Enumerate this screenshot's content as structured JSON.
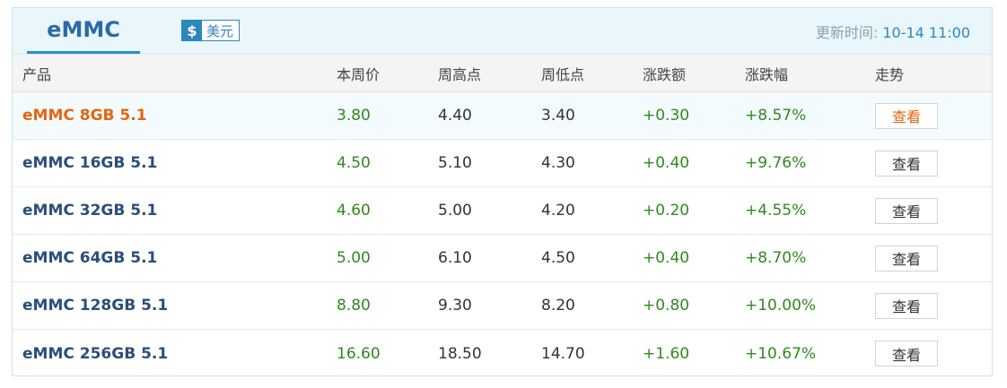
{
  "tab": {
    "label": "eMMC"
  },
  "currency": {
    "symbol": "$",
    "label": "美元"
  },
  "updated": {
    "label": "更新时间: ",
    "value": "10-14 11:00"
  },
  "columns": [
    "产品",
    "本周价",
    "周高点",
    "周低点",
    "涨跌额",
    "涨跌幅",
    "走势"
  ],
  "rows": [
    {
      "name": "eMMC 8GB 5.1",
      "price": "3.80",
      "high": "4.40",
      "low": "3.40",
      "change": "+0.30",
      "pct": "+8.57%",
      "action": "查看"
    },
    {
      "name": "eMMC 16GB 5.1",
      "price": "4.50",
      "high": "5.10",
      "low": "4.30",
      "change": "+0.40",
      "pct": "+9.76%",
      "action": "查看"
    },
    {
      "name": "eMMC 32GB 5.1",
      "price": "4.60",
      "high": "5.00",
      "low": "4.20",
      "change": "+0.20",
      "pct": "+4.55%",
      "action": "查看"
    },
    {
      "name": "eMMC 64GB 5.1",
      "price": "5.00",
      "high": "6.10",
      "low": "4.50",
      "change": "+0.40",
      "pct": "+8.70%",
      "action": "查看"
    },
    {
      "name": "eMMC 128GB 5.1",
      "price": "8.80",
      "high": "9.30",
      "low": "8.20",
      "change": "+0.80",
      "pct": "+10.00%",
      "action": "查看"
    },
    {
      "name": "eMMC 256GB 5.1",
      "price": "16.60",
      "high": "18.50",
      "low": "14.70",
      "change": "+1.60",
      "pct": "+10.67%",
      "action": "查看"
    }
  ],
  "colors": {
    "accent": "#2f86bd",
    "highlight": "#e4660e",
    "up": "#2e8a1c",
    "product": "#2a4e7a"
  }
}
